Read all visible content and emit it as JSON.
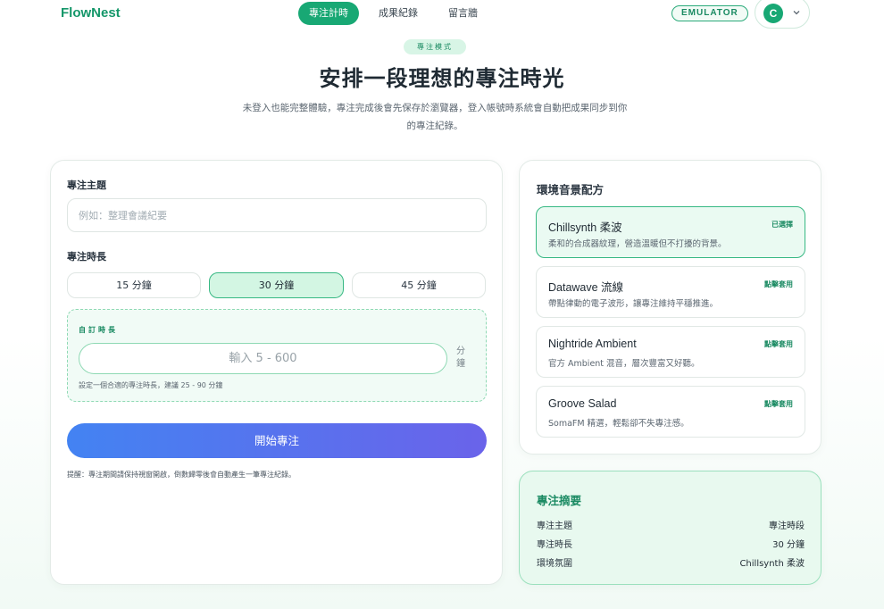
{
  "header": {
    "logo": "FlowNest",
    "nav": [
      "專注計時",
      "成果紀錄",
      "留言牆"
    ],
    "active_nav": 0,
    "emulator_badge": "EMULATOR",
    "avatar_initial": "C"
  },
  "hero": {
    "badge": "專注模式",
    "title": "安排一段理想的專注時光",
    "subtitle_line1": "未登入也能完整體驗，專注完成後會先保存於瀏覽器，登入帳號時系統會自動把成果同步到你",
    "subtitle_line2": "的專注紀錄。"
  },
  "form": {
    "topic_label": "專注主題",
    "topic_placeholder": "例如：整理會議紀要",
    "topic_value": "",
    "duration_label": "專注時長",
    "durations": [
      "15 分鐘",
      "30 分鐘",
      "45 分鐘"
    ],
    "selected_duration": 1,
    "custom_label": "自訂時長",
    "custom_placeholder": "輸入 5 - 600",
    "custom_unit": "分鐘",
    "custom_hint": "設定一個合適的專注時長，建議 25 - 90 分鐘",
    "start_button": "開始專注",
    "footnote": "提醒：專注期間請保持視窗開啟，倒數歸零後會自動產生一筆專注紀錄。"
  },
  "sound": {
    "title": "環境音景配方",
    "tracks": [
      {
        "name": "Chillsynth 柔波",
        "desc": "柔和的合成器紋理，營造溫暖但不打擾的背景。",
        "status": "已選擇"
      },
      {
        "name": "Datawave 流線",
        "desc": "帶點律動的電子波形，讓專注維持平穩推進。",
        "status": "點擊套用"
      },
      {
        "name": "Nightride Ambient",
        "desc": "官方 Ambient 混音，層次豐富又好聽。",
        "status": "點擊套用"
      },
      {
        "name": "Groove Salad",
        "desc": "SomaFM 精選，輕鬆卻不失專注感。",
        "status": "點擊套用"
      }
    ]
  },
  "summary": {
    "title": "專注摘要",
    "rows": [
      {
        "key": "專注主題",
        "value": "專注時段"
      },
      {
        "key": "專注時長",
        "value": "30 分鐘"
      },
      {
        "key": "環境氛圍",
        "value": "Chillsynth 柔波"
      }
    ]
  },
  "colors": {
    "brand": "#18a874",
    "start_gradient_from": "#4383f2",
    "start_gradient_to": "#6a63ea"
  }
}
